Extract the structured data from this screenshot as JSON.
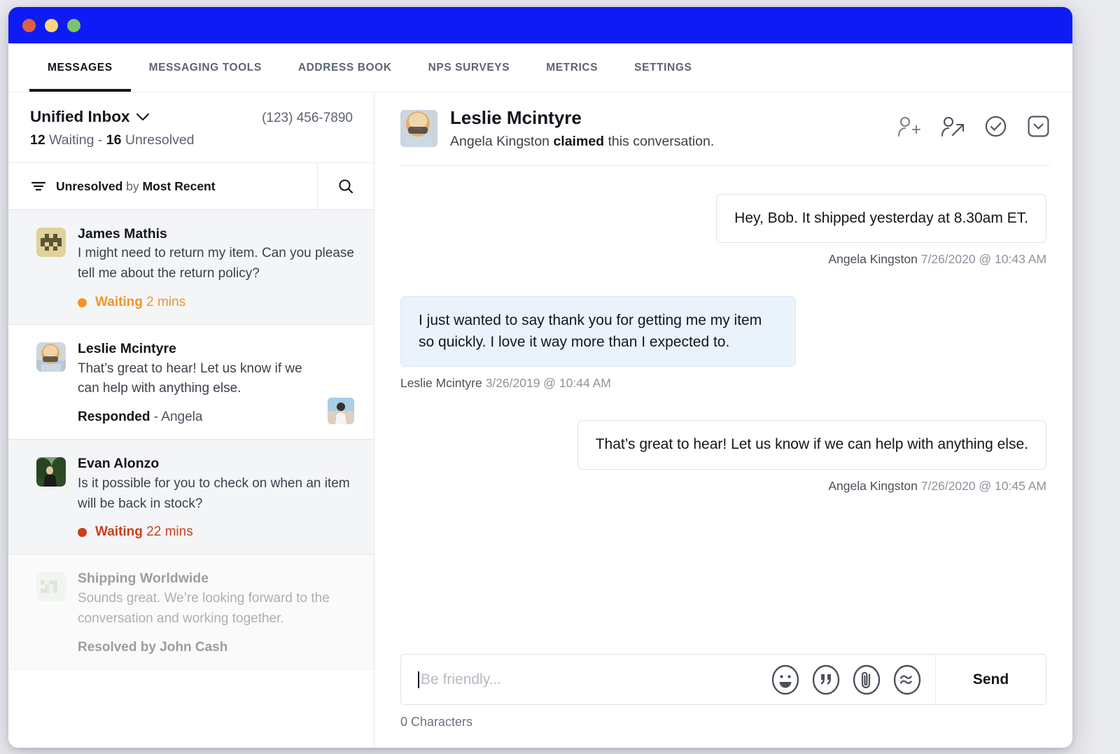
{
  "window": {
    "titlebar_color": "#0f1bf5",
    "traffic_lights": [
      "close",
      "minimize",
      "maximize"
    ]
  },
  "nav": {
    "tabs": [
      {
        "label": "MESSAGES",
        "active": true
      },
      {
        "label": "MESSAGING TOOLS",
        "active": false
      },
      {
        "label": "ADDRESS BOOK",
        "active": false
      },
      {
        "label": "NPS SURVEYS",
        "active": false
      },
      {
        "label": "METRICS",
        "active": false
      },
      {
        "label": "SETTINGS",
        "active": false
      }
    ]
  },
  "inbox": {
    "title": "Unified Inbox",
    "phone": "(123) 456-7890",
    "counts": {
      "waiting_number": "12",
      "waiting_label": " Waiting - ",
      "unresolved_number": "16",
      "unresolved_label": " Unresolved"
    },
    "filter": {
      "primary": "Unresolved",
      "connector": " by ",
      "secondary": "Most Recent"
    },
    "conversations": [
      {
        "name": "James Mathis",
        "snippet": "I might need to return my item. Can you please tell me about the return policy?",
        "status_label": "Waiting",
        "status_time": " 2 mins",
        "status_color": "#f29528",
        "avatar_type": "identicon-khaki",
        "selected": true,
        "muted": false
      },
      {
        "name": "Leslie Mcintyre",
        "snippet": "That’s great to hear! Let us know if we can help with anything else.",
        "status_label": "Responded",
        "status_time": " - Angela",
        "status_color": "#14161c",
        "avatar_type": "photo-blonde",
        "selected": false,
        "muted": false,
        "thumbnail": "photo-beach"
      },
      {
        "name": "Evan Alonzo",
        "snippet": "Is it possible for you to check on when an item will be back in stock?",
        "status_label": "Waiting",
        "status_time": " 22 mins",
        "status_color": "#cc3f18",
        "avatar_type": "photo-green",
        "selected": true,
        "muted": false
      },
      {
        "name": "Shipping Worldwide",
        "snippet": "Sounds great. We’re looking forward to the conversation and working together.",
        "status_label": "Resolved by John Cash",
        "status_time": "",
        "status_color": "#14161c",
        "avatar_type": "identicon-green",
        "selected": false,
        "muted": true
      }
    ]
  },
  "conversation": {
    "contact_name": "Leslie Mcintyre",
    "claim_prefix": "Angela Kingston ",
    "claim_bold": "claimed",
    "claim_suffix": " this conversation.",
    "actions": [
      {
        "name": "add-person-icon",
        "title": "Add person"
      },
      {
        "name": "forward-person-icon",
        "title": "Assign"
      },
      {
        "name": "check-circle-icon",
        "title": "Resolve"
      },
      {
        "name": "chevron-down-box-icon",
        "title": "More"
      }
    ],
    "messages": [
      {
        "direction": "out",
        "text": "Hey, Bob. It shipped yesterday at 8.30am ET.",
        "author": "Angela Kingston",
        "timestamp": "7/26/2020 @ 10:43 AM"
      },
      {
        "direction": "in",
        "text": "I just wanted to say thank you for getting me my item so quickly. I love it way more than I expected to.",
        "author": "Leslie Mcintyre",
        "timestamp": "3/26/2019 @ 10:44 AM"
      },
      {
        "direction": "out",
        "text": "That’s great to hear! Let us know if we can help with anything else.",
        "author": "Angela Kingston",
        "timestamp": "7/26/2020 @ 10:45 AM"
      }
    ]
  },
  "composer": {
    "value": "",
    "placeholder": "Be friendly...",
    "tools": [
      {
        "name": "emoji-icon"
      },
      {
        "name": "quote-icon"
      },
      {
        "name": "attachment-icon"
      },
      {
        "name": "tilde-icon"
      }
    ],
    "send_label": "Send",
    "char_count": "0 Characters"
  }
}
